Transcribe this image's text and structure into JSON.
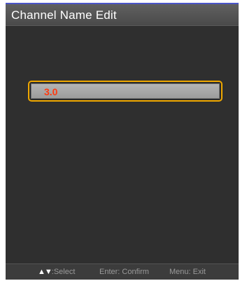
{
  "title_bar": {
    "title": "Channel Name Edit"
  },
  "channel_name_field": {
    "value": "3.0"
  },
  "help_bar": {
    "select_arrows": "▲▼",
    "select_label": ":Select",
    "confirm_label": "Enter: Confirm",
    "exit_label": "Menu: Exit"
  },
  "colors": {
    "field_border": "#f0a800",
    "field_text": "#ff3a10",
    "background": "#2f2f2f"
  }
}
